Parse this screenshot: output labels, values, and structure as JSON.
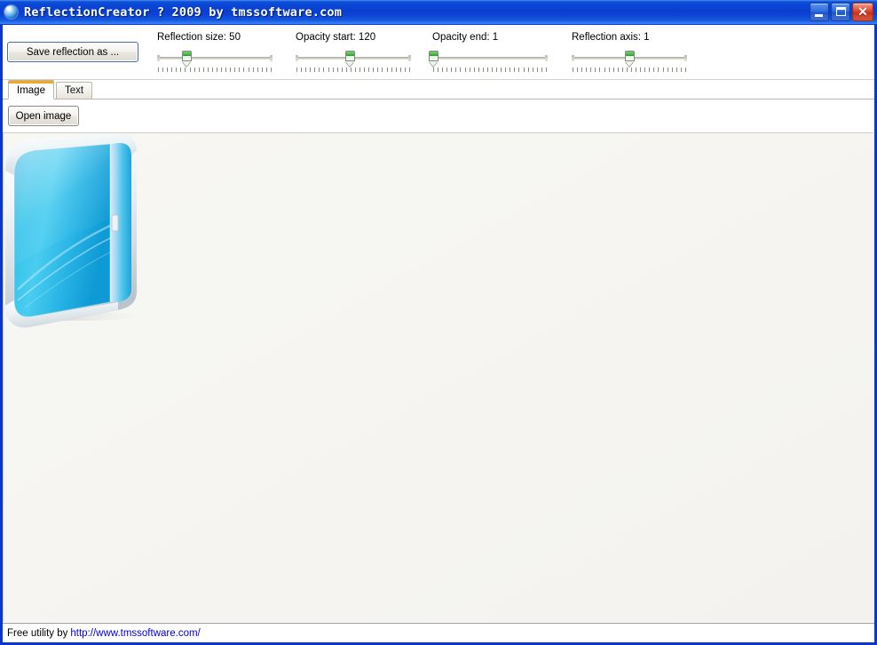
{
  "window": {
    "title": "ReflectionCreator ? 2009 by tmssoftware.com",
    "icon": "sphere-icon",
    "accent_titlebar": "#0a3ed0",
    "controls": {
      "minimize": "_",
      "maximize": "□",
      "close": "✕"
    }
  },
  "toolbar": {
    "save_label": "Save reflection as ...",
    "sliders": [
      {
        "name": "reflection-size",
        "label": "Reflection size: 50",
        "caption": "Reflection size:",
        "value": 50,
        "percent": 25,
        "ticks": 26
      },
      {
        "name": "opacity-start",
        "label": "Opacity start:  120",
        "caption": "Opacity start:",
        "value": 120,
        "percent": 47,
        "ticks": 26
      },
      {
        "name": "opacity-end",
        "label": "Opacity end:  1",
        "caption": "Opacity end:",
        "value": 1,
        "percent": 1,
        "ticks": 26
      },
      {
        "name": "reflection-axis",
        "label": "Reflection axis: 1",
        "caption": "Reflection axis:",
        "value": 1,
        "percent": 50,
        "ticks": 26
      }
    ]
  },
  "tabs": [
    {
      "label": "Image",
      "active": true
    },
    {
      "label": "Text",
      "active": false
    }
  ],
  "image_tab": {
    "open_label": "Open image",
    "preview_background": "#f6f5f1",
    "artwork": {
      "name": "software-box-with-reflection",
      "box_color": "#22b4e4",
      "edge_color": "#e8eef2"
    }
  },
  "statusbar": {
    "prefix": "Free utility by",
    "link": "http://www.tmssoftware.com/"
  }
}
